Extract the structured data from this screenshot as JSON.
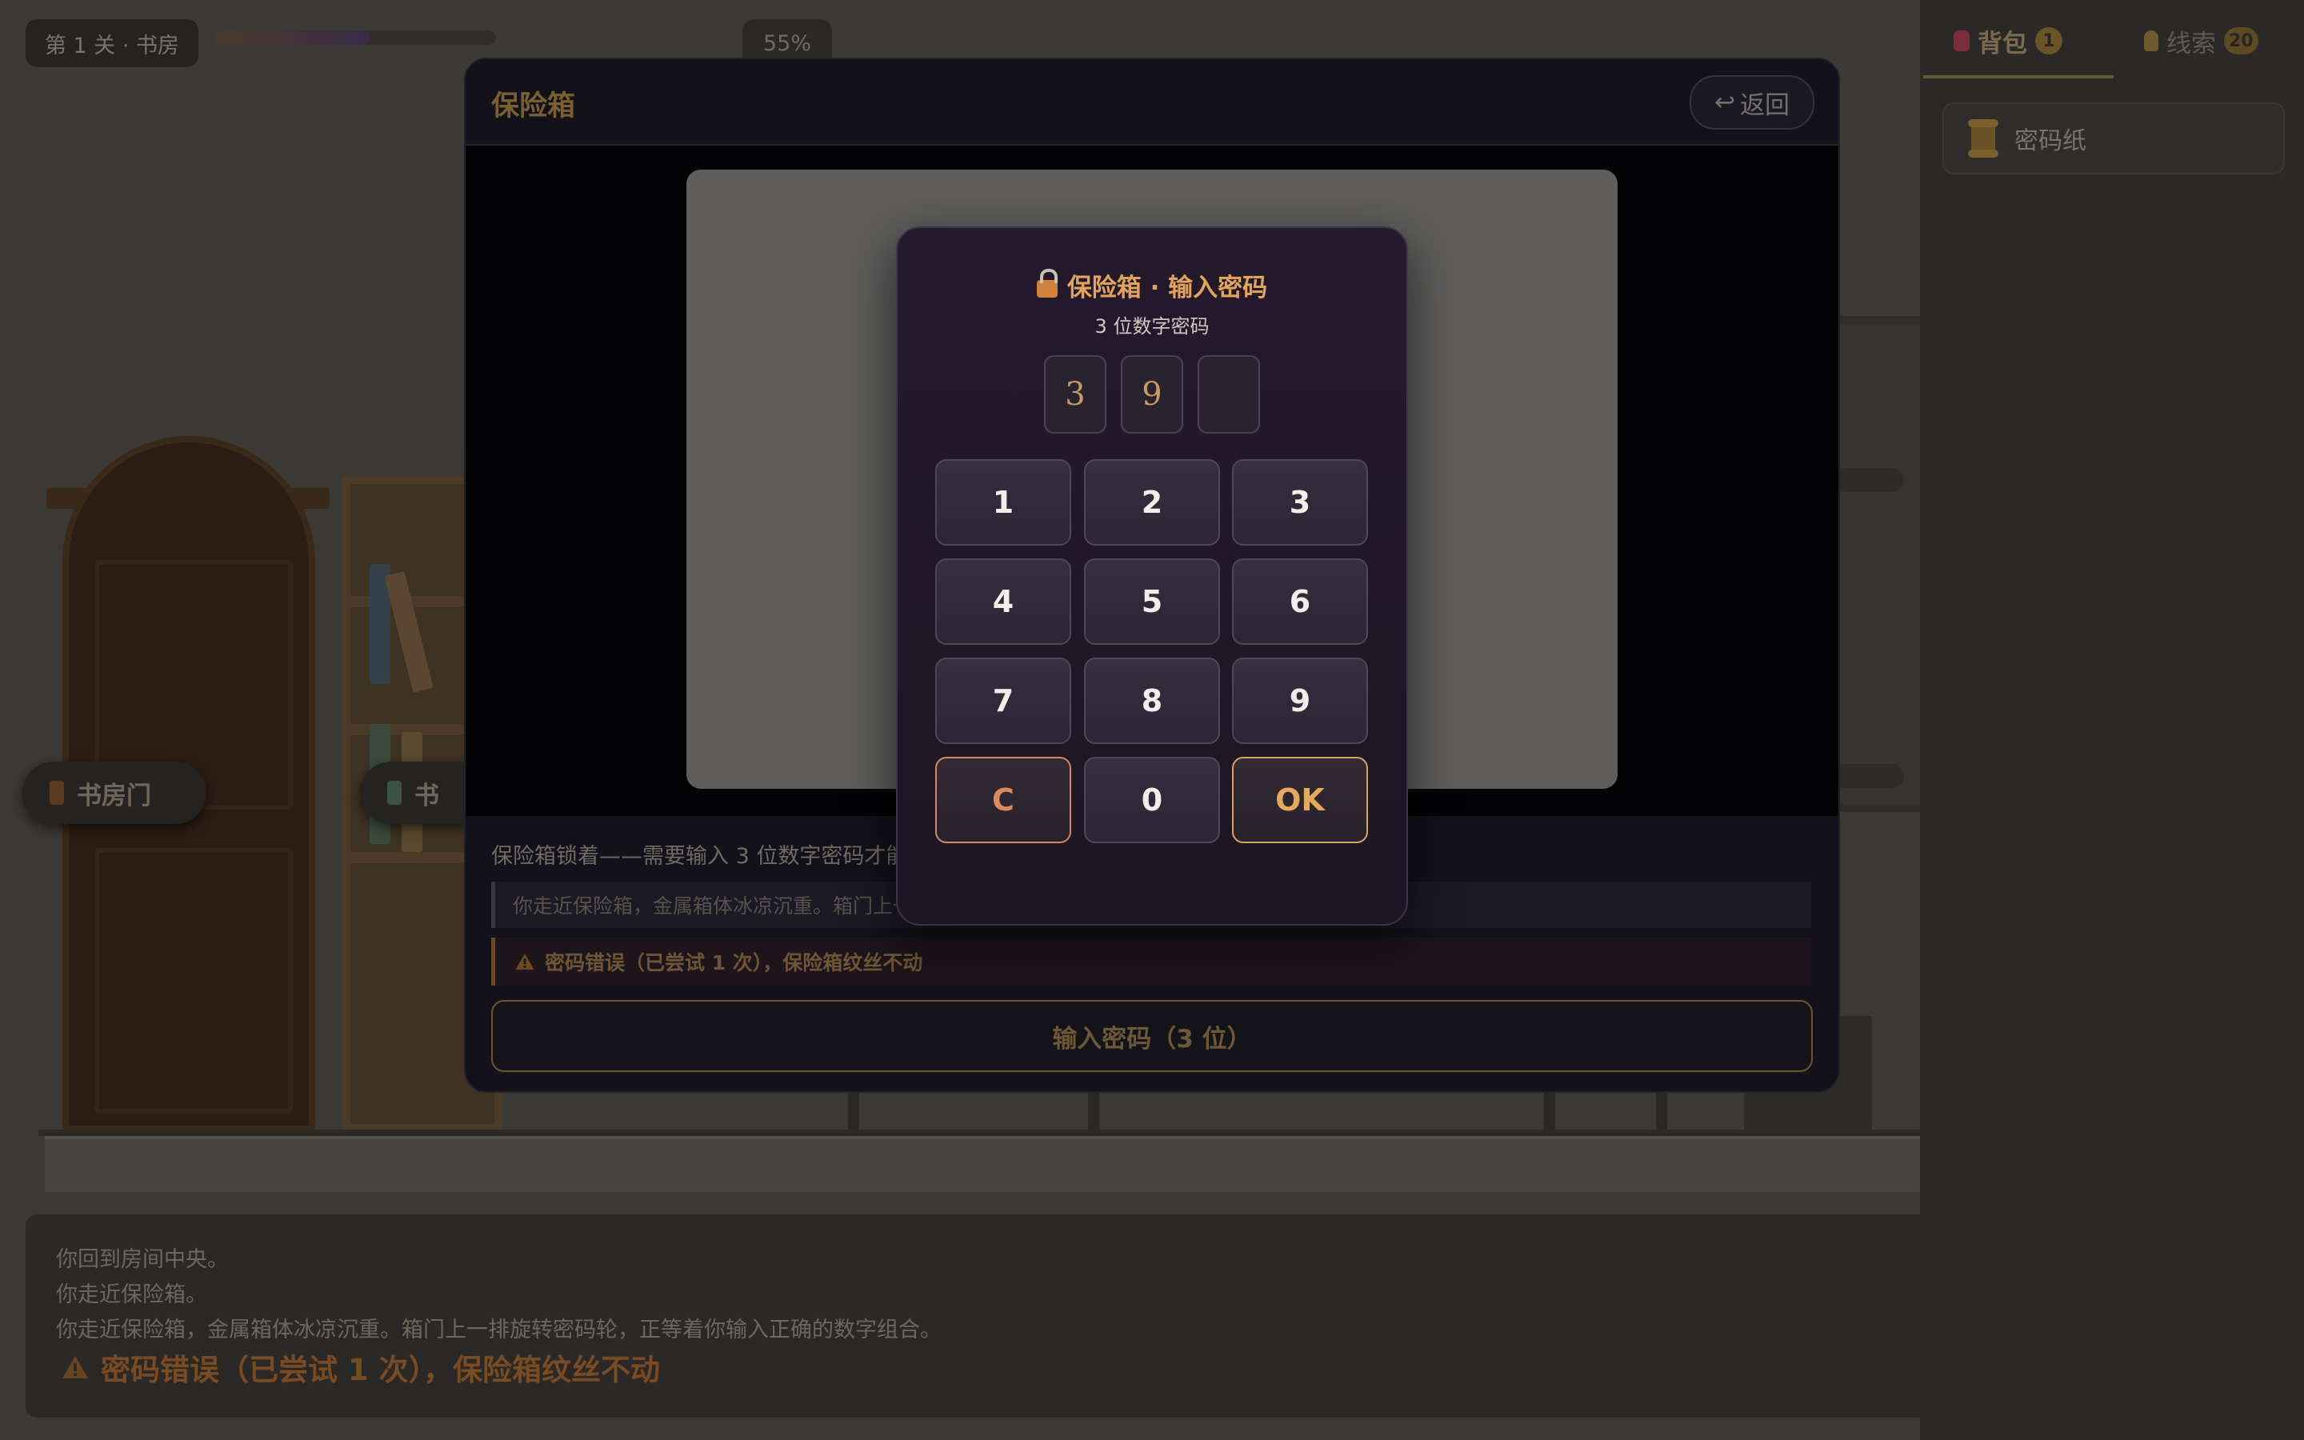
{
  "hud": {
    "level": "第 1 关 · 书房",
    "progress_fraction": 0.55,
    "progress_text": "55%"
  },
  "hotspots": {
    "door_label": "书房门",
    "shelf_label": "书"
  },
  "side_panel": {
    "tabs": [
      {
        "label": "背包",
        "count": "1",
        "icon": "backpack-icon"
      },
      {
        "label": "线索",
        "count": "20",
        "icon": "lightbulb-icon"
      }
    ],
    "items": [
      {
        "label": "密码纸",
        "icon": "scroll-icon"
      }
    ]
  },
  "log": {
    "lines": [
      "你回到房间中央。",
      "你走近保险箱。",
      "你走近保险箱，金属箱体冰凉沉重。箱门上一排旋转密码轮，正等着你输入正确的数字组合。"
    ],
    "warning": "密码错误（已尝试 1 次），保险箱纹丝不动"
  },
  "safe_modal": {
    "title": "保险箱",
    "back_label": "返回",
    "description": "保险箱锁着——需要输入 3 位数字密码才能",
    "note": "你走近保险箱，金属箱体冰凉沉重。箱门上一",
    "warning": "密码错误（已尝试 1 次），保险箱纹丝不动",
    "enter_label": "输入密码（3 位）"
  },
  "keypad": {
    "title": "保险箱 · 输入密码",
    "subtitle": "3 位数字密码",
    "digits": [
      "3",
      "9",
      ""
    ],
    "keys": [
      "1",
      "2",
      "3",
      "4",
      "5",
      "6",
      "7",
      "8",
      "9",
      "C",
      "0",
      "OK"
    ]
  },
  "colors": {
    "accent": "#e2a35a",
    "clear_key": "#d98a5f",
    "warning_text": "#7a4a23"
  }
}
